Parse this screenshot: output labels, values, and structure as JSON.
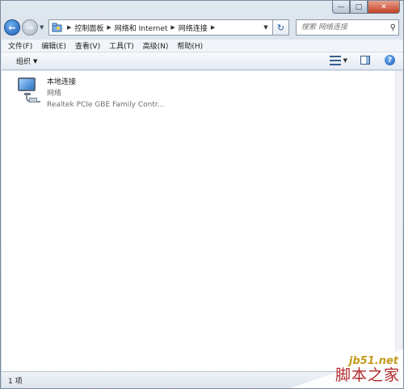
{
  "addressbar": {
    "crumbs": [
      "控制面板",
      "网络和 Internet",
      "网络连接"
    ],
    "search_placeholder": "搜索 网络连接"
  },
  "menubar": {
    "items": [
      "文件(F)",
      "编辑(E)",
      "查看(V)",
      "工具(T)",
      "高级(N)",
      "帮助(H)"
    ]
  },
  "commandbar": {
    "organize_label": "组织"
  },
  "connections": [
    {
      "name": "本地连接",
      "status": "网络",
      "adapter": "Realtek PCIe GBE Family Contr..."
    }
  ],
  "statusbar": {
    "count": "1 项"
  },
  "watermark": {
    "domain": "jb51.net",
    "name": "脚本之家"
  },
  "colors": {
    "accent": "#1d5fb7",
    "close": "#c33f22"
  }
}
